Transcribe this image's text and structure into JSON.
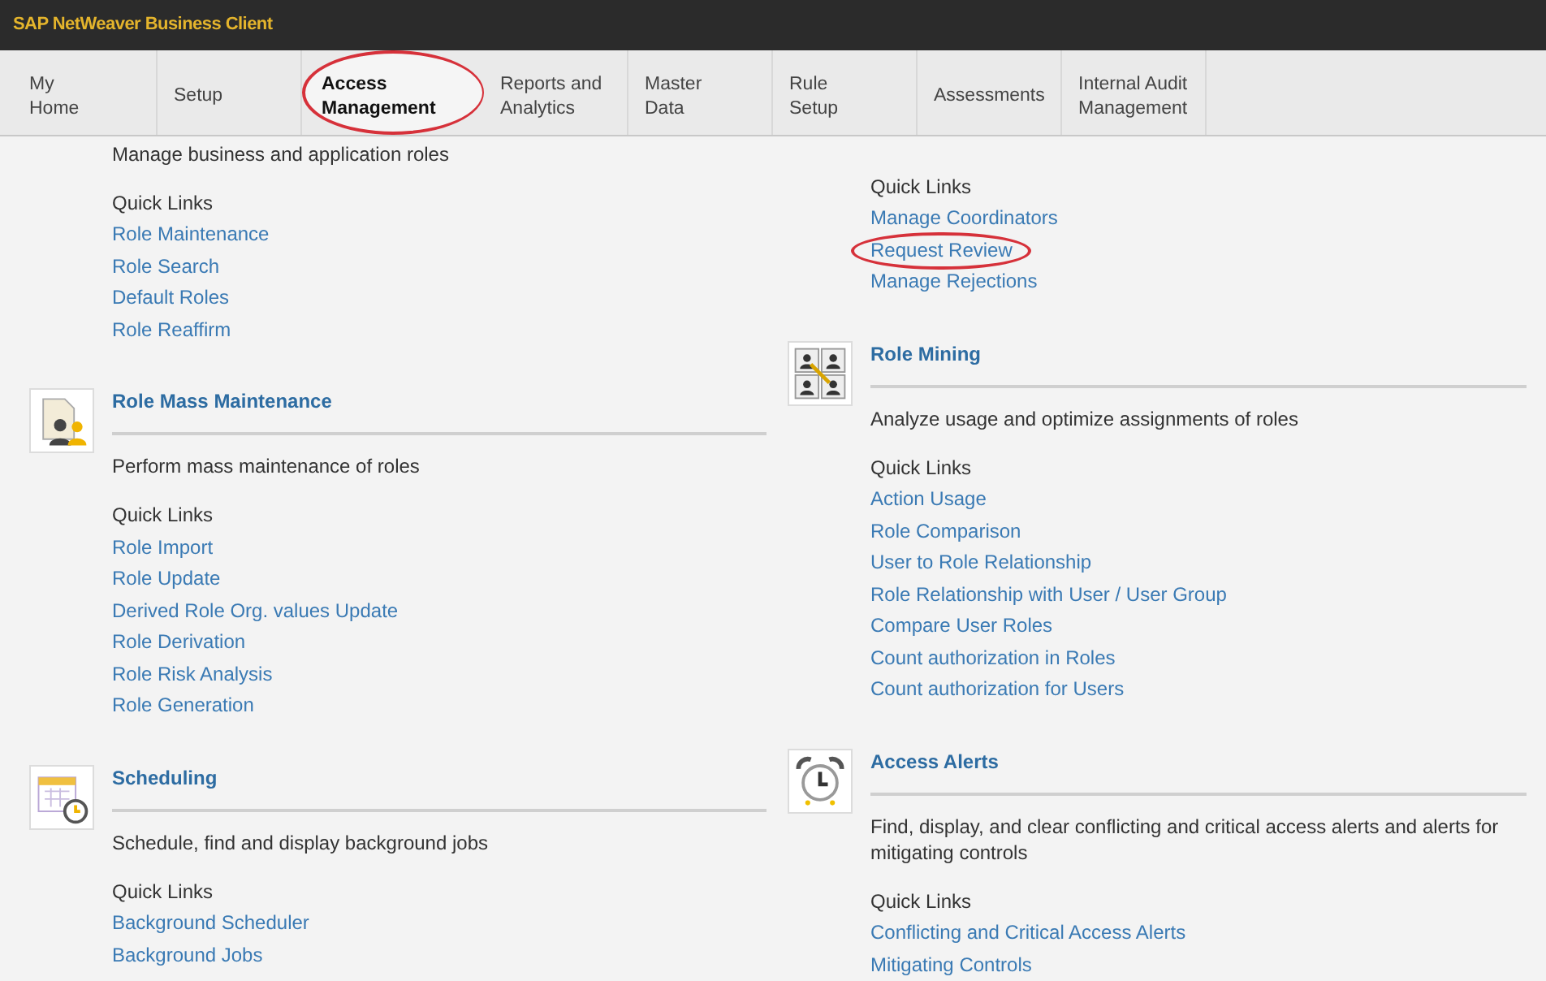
{
  "window": {
    "title": "SAP NetWeaver Business Client"
  },
  "tabs": [
    {
      "label": "My\nHome",
      "selected": false,
      "circled": false
    },
    {
      "label": "Setup",
      "selected": false,
      "circled": false
    },
    {
      "label": "Access\nManagement",
      "selected": true,
      "circled": true
    },
    {
      "label": "Reports and\nAnalytics",
      "selected": false,
      "circled": false
    },
    {
      "label": "Master\nData",
      "selected": false,
      "circled": false
    },
    {
      "label": "Rule\nSetup",
      "selected": false,
      "circled": false
    },
    {
      "label": "Assessments",
      "selected": false,
      "circled": false
    },
    {
      "label": "Internal Audit\nManagement",
      "selected": false,
      "circled": false
    }
  ],
  "columns": [
    {
      "sections": [
        {
          "kind": "continued",
          "description": "Manage business and application roles",
          "quick_links_label": "Quick Links",
          "links": [
            {
              "label": "Role Maintenance",
              "circled": false
            },
            {
              "label": "Role Search",
              "circled": false
            },
            {
              "label": "Default Roles",
              "circled": false
            },
            {
              "label": "Role Reaffirm",
              "circled": false
            }
          ]
        },
        {
          "kind": "roles",
          "title": "Role Mass Maintenance",
          "description": "Perform mass maintenance of roles",
          "quick_links_label": "Quick Links",
          "links": [
            {
              "label": "Role Import",
              "circled": false
            },
            {
              "label": "Role Update",
              "circled": false
            },
            {
              "label": "Derived Role Org. values Update",
              "circled": false
            },
            {
              "label": "Role Derivation",
              "circled": false
            },
            {
              "label": "Role Risk Analysis",
              "circled": false
            },
            {
              "label": "Role Generation",
              "circled": false
            }
          ]
        },
        {
          "kind": "calendar",
          "title": "Scheduling",
          "description": "Schedule, find and display background jobs",
          "quick_links_label": "Quick Links",
          "links": [
            {
              "label": "Background Scheduler",
              "circled": false
            },
            {
              "label": "Background Jobs",
              "circled": false
            }
          ]
        }
      ]
    },
    {
      "sections": [
        {
          "kind": "continued",
          "quick_links_label": "Quick Links",
          "links": [
            {
              "label": "Manage Coordinators",
              "circled": false
            },
            {
              "label": "Request Review",
              "circled": true
            },
            {
              "label": "Manage Rejections",
              "circled": false
            }
          ]
        },
        {
          "kind": "users",
          "title": "Role Mining",
          "description": "Analyze usage and optimize assignments of roles",
          "quick_links_label": "Quick Links",
          "links": [
            {
              "label": "Action Usage",
              "circled": false
            },
            {
              "label": "Role Comparison",
              "circled": false
            },
            {
              "label": "User to Role Relationship",
              "circled": false
            },
            {
              "label": "Role Relationship with User / User Group",
              "circled": false
            },
            {
              "label": "Compare User Roles",
              "circled": false
            },
            {
              "label": "Count authorization in Roles",
              "circled": false
            },
            {
              "label": "Count authorization for Users",
              "circled": false
            }
          ]
        },
        {
          "kind": "alarm",
          "title": "Access Alerts",
          "description": "Find, display, and clear conflicting and critical access alerts and alerts for mitigating controls",
          "quick_links_label": "Quick Links",
          "links": [
            {
              "label": "Conflicting and Critical Access Alerts",
              "circled": false
            },
            {
              "label": "Mitigating Controls",
              "circled": false
            }
          ]
        }
      ]
    }
  ]
}
